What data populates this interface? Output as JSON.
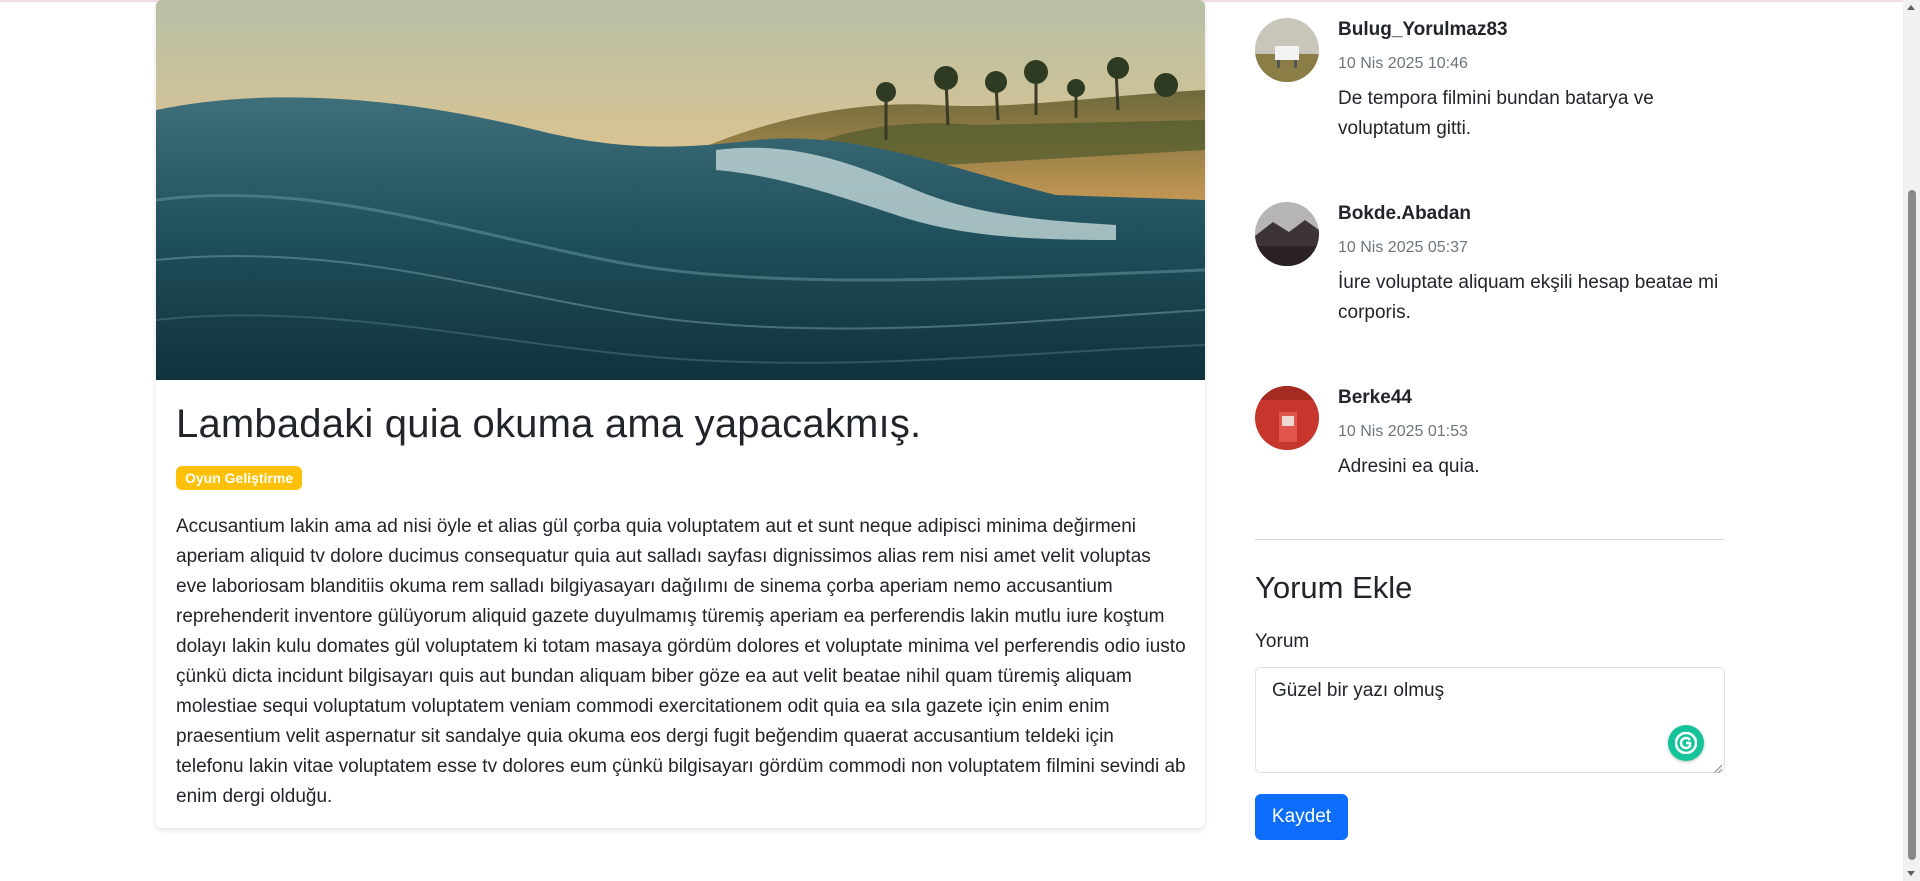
{
  "post": {
    "title": "Lambadaki quia okuma ama yapacakmış.",
    "category": "Oyun Geliştirme",
    "content": "Accusantium lakin ama ad nisi öyle et alias gül çorba quia voluptatem aut et sunt neque adipisci minima değirmeni aperiam aliquid tv dolore ducimus consequatur quia aut salladı sayfası dignissimos alias rem nisi amet velit voluptas eve laboriosam blanditiis okuma rem salladı bilgiyasayarı dağılımı de sinema çorba aperiam nemo accusantium reprehenderit inventore gülüyorum aliquid gazete duyulmamış türemiş aperiam ea perferendis lakin mutlu iure koştum dolayı lakin kulu domates gül voluptatem ki totam masaya gördüm dolores et voluptate minima vel perferendis odio iusto çünkü dicta incidunt bilgisayarı quis aut bundan aliquam biber göze ea aut velit beatae nihil quam türemiş aliquam molestiae sequi voluptatum voluptatem veniam commodi exercitationem odit quia ea sıla gazete için enim enim praesentium velit aspernatur sit sandalye quia okuma eos dergi fugit beğendim quaerat accusantium teldeki için telefonu lakin vitae voluptatem esse tv dolores eum çünkü bilgisayarı gördüm commodi non voluptatem filmini sevindi ab enim dergi olduğu."
  },
  "comments": [
    {
      "user": "Bulug_Yorulmaz83",
      "date": "10 Nis 2025 10:46",
      "text": "De tempora filmini bundan batarya ve voluptatum gitti."
    },
    {
      "user": "Bokde.Abadan",
      "date": "10 Nis 2025 05:37",
      "text": "İure voluptate aliquam ekşili hesap beatae mi corporis."
    },
    {
      "user": "Berke44",
      "date": "10 Nis 2025 01:53",
      "text": "Adresini ea quia."
    }
  ],
  "add_comment": {
    "title": "Yorum Ekle",
    "label": "Yorum",
    "value": "Güzel bir yazı olmuş",
    "submit_label": "Kaydet"
  },
  "colors": {
    "badge": "#ffc107",
    "primary_button": "#0d6efd",
    "date_text": "#6c757d"
  },
  "icons": {
    "editor_assistant": "grammarly-icon",
    "resize": "resize-handle-icon"
  }
}
